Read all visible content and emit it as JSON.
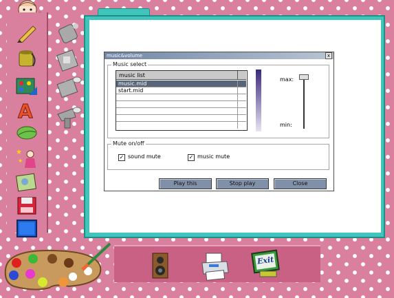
{
  "dialog": {
    "title": "music&volume",
    "close_glyph": "x",
    "music_group_label": "Music select",
    "list_header": "music list",
    "tracks": [
      "music.mid",
      "start.mid"
    ],
    "selected_index": 0,
    "max_label": "max:",
    "min_label": "min:",
    "volume_level": 1.0,
    "mute_group_label": "Mute on/off",
    "sound_mute": {
      "label": "sound mute",
      "checked": true
    },
    "music_mute": {
      "label": "music mute",
      "checked": true
    },
    "buttons": {
      "play": "Play this",
      "stop": "Stop play",
      "close": "Close"
    }
  },
  "toolbar_bottom": {
    "exit_label": "Exit"
  },
  "colors": {
    "background": "#d9809f",
    "canvas_frame": "#40c4bb",
    "dialog_button": "#7f90a8",
    "selected_row": "#59667a"
  },
  "icons": {
    "left_tools": [
      "pencil-icon",
      "paint-bucket-icon",
      "stamp-palette-icon",
      "text-tool-icon",
      "eraser-leaf-icon",
      "magic-fairy-icon",
      "photo-icon",
      "save-disk-icon",
      "screen-icon"
    ],
    "side_tools": [
      "spray-tool-icon",
      "fill-pattern-icon",
      "brush-tool-icon",
      "hairdryer-icon"
    ],
    "bottom": [
      "speaker-icon",
      "printer-icon",
      "exit-monitor-icon",
      "palette-icon"
    ]
  }
}
